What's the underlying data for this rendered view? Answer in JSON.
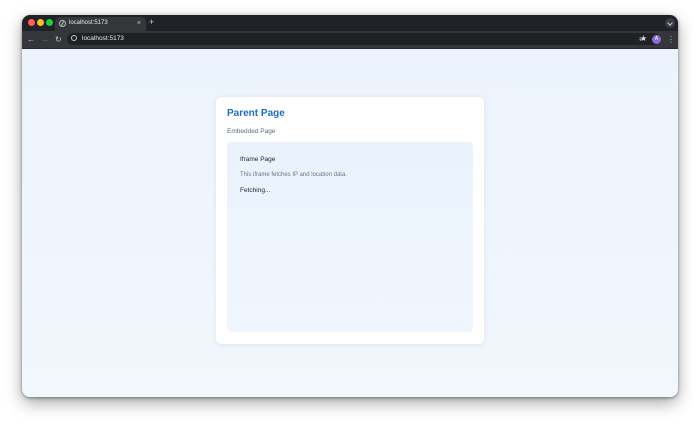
{
  "browser": {
    "tab_title": "localhost:5173",
    "tab_close": "×",
    "new_tab": "+",
    "url": "localhost:5173",
    "nav": {
      "back": "←",
      "forward": "→",
      "reload": "↻"
    },
    "bookmark_star": "★",
    "extensions": "⇄",
    "avatar_initial": "A",
    "menu": "⋮",
    "icons": [
      "globe-icon",
      "info-icon",
      "star-icon",
      "extensions-icon",
      "kebab-menu-icon",
      "chevron-down-icon"
    ]
  },
  "page": {
    "title": "Parent Page",
    "embedded_label": "Embedded Page",
    "iframe": {
      "title": "Iframe Page",
      "description": "This iframe fetches IP and location data.",
      "status": "Fetching..."
    }
  },
  "colors": {
    "accent": "#1f6fbf",
    "background": "#eef5fd",
    "card": "#ffffff",
    "browser_chrome": "#35363a"
  }
}
